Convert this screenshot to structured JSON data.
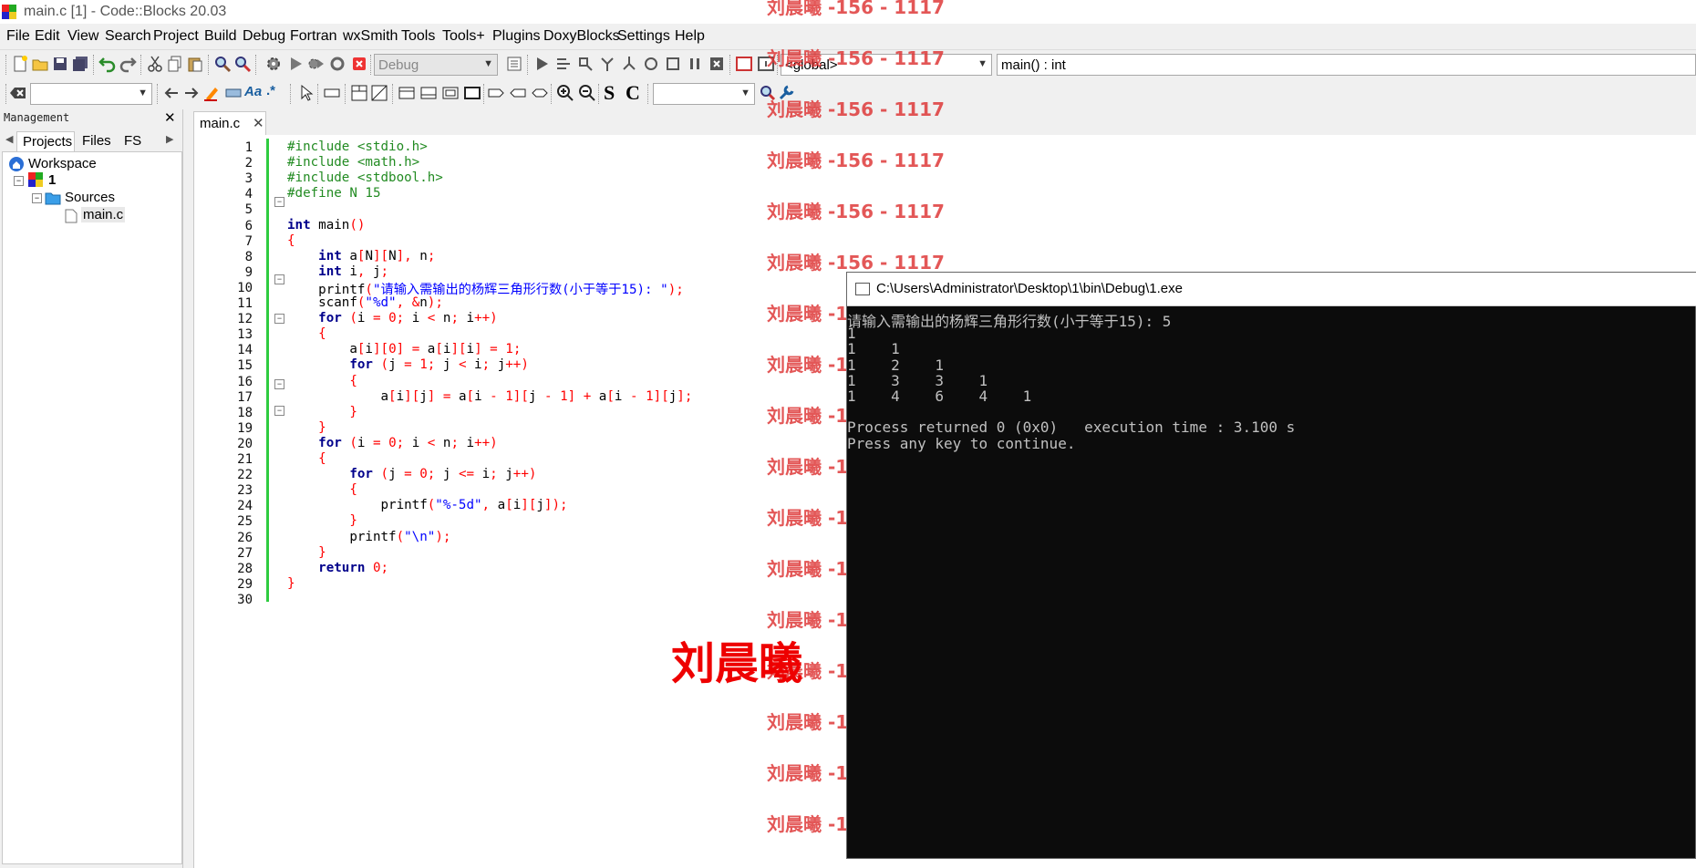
{
  "window": {
    "title": "main.c [1] - Code::Blocks 20.03"
  },
  "menu": [
    "File",
    "Edit",
    "View",
    "Search",
    "Project",
    "Build",
    "Debug",
    "Fortran",
    "wxSmith",
    "Tools",
    "Tools+",
    "Plugins",
    "DoxyBlocks",
    "Settings",
    "Help"
  ],
  "toolbar": {
    "build_target": "Debug",
    "scope": "<global>",
    "function": "main() : int",
    "regex_label": ".*",
    "case_label": "Aa",
    "letter_s": "S",
    "letter_c": "C"
  },
  "management": {
    "title": "Management",
    "tabs": [
      "Projects",
      "Files",
      "FS"
    ],
    "tree": {
      "workspace": "Workspace",
      "project": "1",
      "folder": "Sources",
      "file": "main.c"
    }
  },
  "editor": {
    "tab": "main.c",
    "line_numbers": [
      "1",
      "2",
      "3",
      "4",
      "5",
      "6",
      "7",
      "8",
      "9",
      "10",
      "11",
      "12",
      "13",
      "14",
      "15",
      "16",
      "17",
      "18",
      "19",
      "20",
      "21",
      "22",
      "23",
      "24",
      "25",
      "26",
      "27",
      "28",
      "29",
      "30"
    ],
    "lines": [
      "#include <stdio.h>",
      "#include <math.h>",
      "#include <stdbool.h>",
      "#define N 15",
      "",
      "int main()",
      "{",
      "    int a[N][N], n;",
      "    int i, j;",
      "    printf(\"请输入需输出的杨辉三角形行数(小于等于15): \");",
      "    scanf(\"%d\", &n);",
      "    for (i = 0; i < n; i++)",
      "    {",
      "        a[i][0] = a[i][i] = 1;",
      "        for (j = 1; j < i; j++)",
      "        {",
      "            a[i][j] = a[i - 1][j - 1] + a[i - 1][j];",
      "        }",
      "    }",
      "    for (i = 0; i < n; i++)",
      "    {",
      "        for (j = 0; j <= i; j++)",
      "        {",
      "            printf(\"%-5d\", a[i][j]);",
      "        }",
      "        printf(\"\\n\");",
      "    }",
      "    return 0;",
      "}",
      ""
    ]
  },
  "console": {
    "title": "C:\\Users\\Administrator\\Desktop\\1\\bin\\Debug\\1.exe",
    "lines": [
      "请输入需输出的杨辉三角形行数(小于等于15): 5",
      "1",
      "1    1",
      "1    2    1",
      "1    3    3    1",
      "1    4    6    4    1",
      "",
      "Process returned 0 (0x0)   execution time : 3.100 s",
      "Press any key to continue."
    ]
  },
  "watermark": {
    "repeat_text": "刘晨曦 -156 - 1117",
    "big_text": "刘晨曦"
  },
  "colors": {
    "accent_green": "#2ecc40",
    "watermark_red": "#dd3333",
    "console_bg": "#0c0c0c"
  }
}
